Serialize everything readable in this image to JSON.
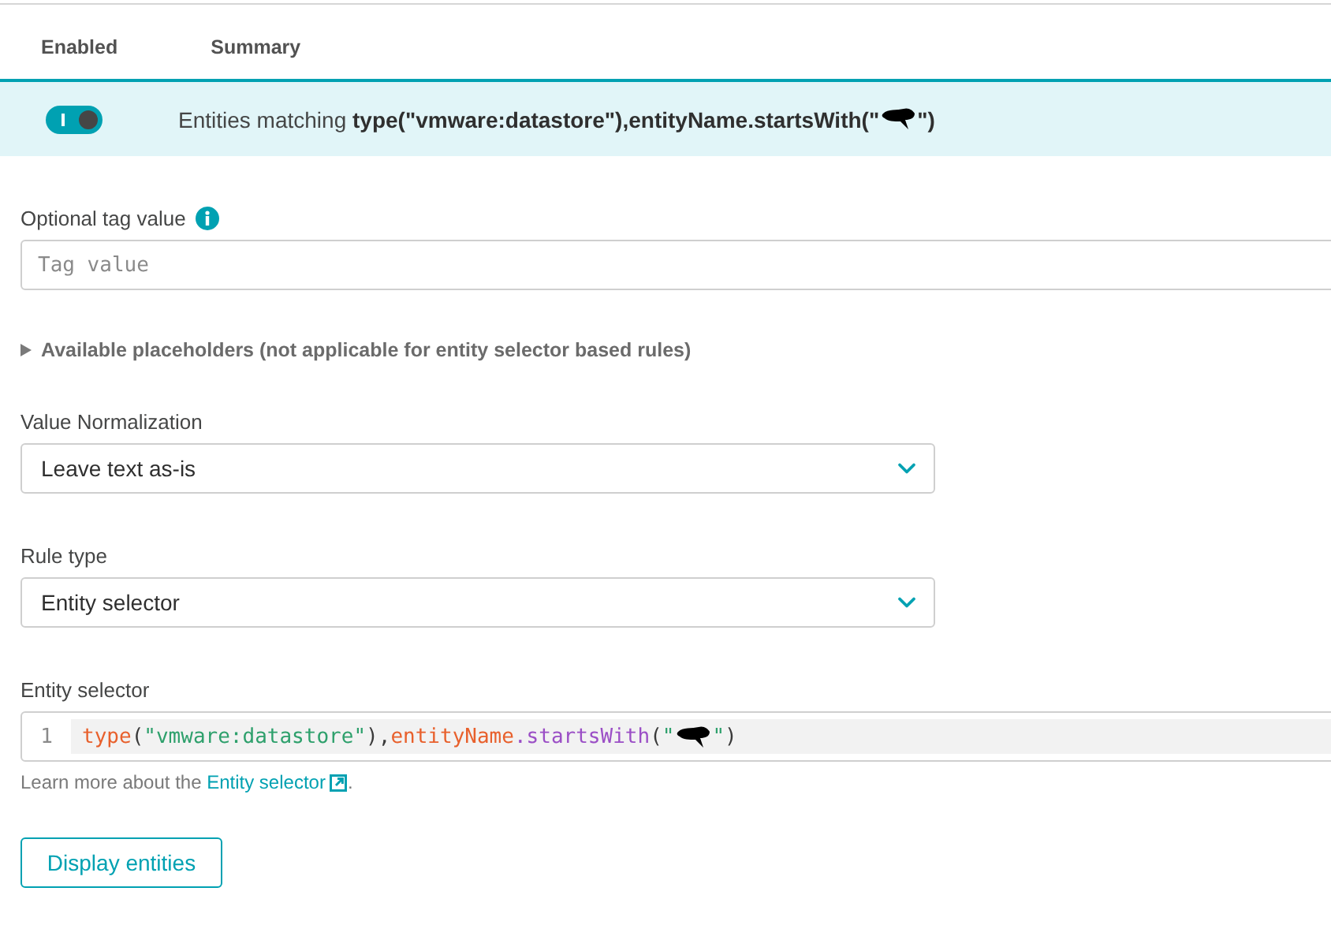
{
  "table": {
    "columns": [
      {
        "label": "Enabled"
      },
      {
        "label": "Summary"
      }
    ],
    "rows": [
      {
        "selected": true,
        "enabled": true,
        "summary": {
          "lead": "Entities matching **type(\"vmware:datastore\"),entityName.startsWith(\"**",
          "redacted": true,
          "tail": "\")"
        }
      }
    ]
  },
  "form": {
    "tag_value": {
      "label": "Optional tag value",
      "placeholder": "Tag value"
    },
    "placeholders": {
      "label": "Available placeholders (not applicable for entity selector based rules)",
      "expanded": false
    },
    "selects": [
      {
        "label": "Value Normalization",
        "value": "Leave text as-is"
      },
      {
        "label": "Rule type",
        "value": "Entity selector"
      }
    ],
    "entity_selector": {
      "label": "Entity selector",
      "line_number": "1",
      "tokens": [
        {
          "kind": "function",
          "text": "type"
        },
        {
          "kind": "punct",
          "text": "("
        },
        {
          "kind": "string",
          "text": "\"vmware:datastore\""
        },
        {
          "kind": "punct",
          "text": "),"
        },
        {
          "kind": "function",
          "text": "entityName"
        },
        {
          "kind": "method",
          "text": ".startsWith"
        },
        {
          "kind": "punct",
          "text": "("
        },
        {
          "kind": "string",
          "text": "\""
        },
        {
          "kind": "redacted"
        },
        {
          "kind": "string",
          "text": "\""
        },
        {
          "kind": "punct",
          "text": ")"
        }
      ],
      "help": {
        "text": "Learn more about the ",
        "link": "Entity selector",
        "end": "."
      }
    },
    "button": "Display entities"
  }
}
